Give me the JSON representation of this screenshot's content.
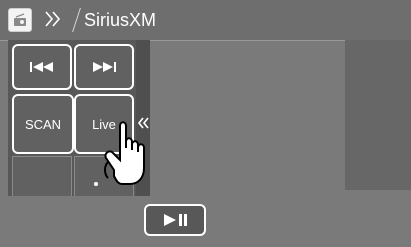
{
  "header": {
    "title": "SiriusXM",
    "source_icon": "radio-source-icon",
    "nav_icon": "double-chevron-right-icon"
  },
  "controls": {
    "prev_icon": "skip-previous-icon",
    "next_icon": "skip-next-icon",
    "scan_label": "SCAN",
    "live_label": "Live",
    "collapse_icon": "double-chevron-left-icon"
  },
  "playback": {
    "play_pause_icon": "play-pause-icon"
  },
  "overlay": {
    "pointer_icon": "hand-pointer-icon"
  },
  "colors": {
    "screen": "#7a7a7a",
    "panel": "#585858",
    "accent": "#ffffff"
  }
}
